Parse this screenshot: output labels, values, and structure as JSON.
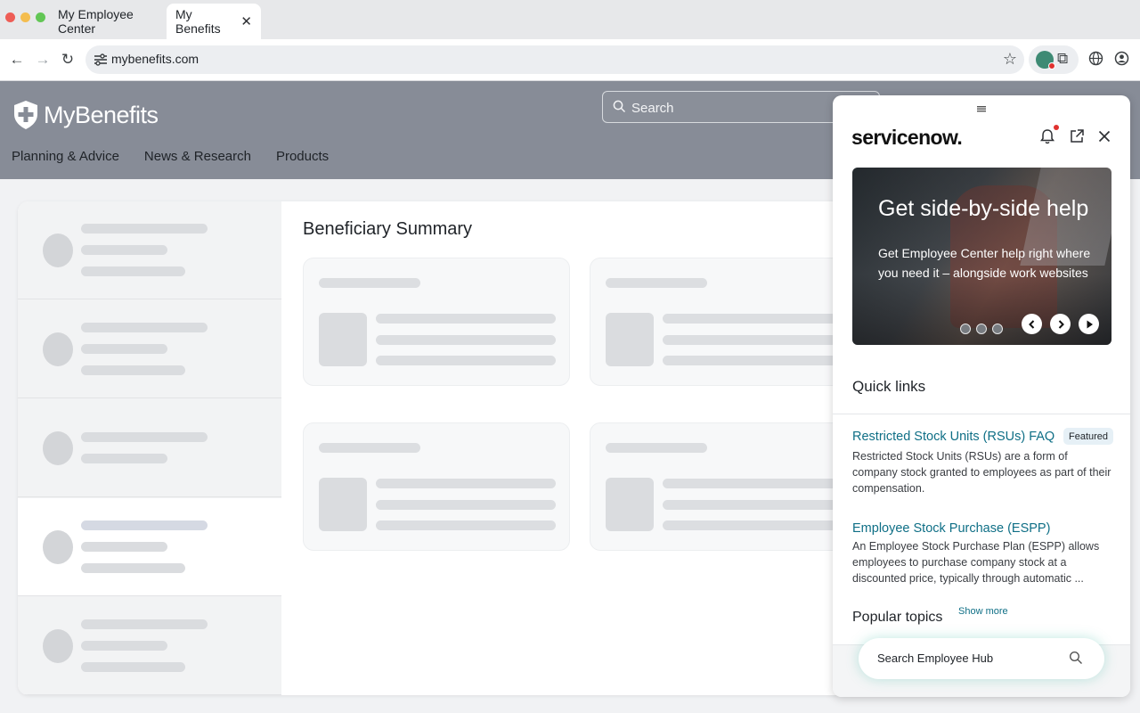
{
  "browser": {
    "tabs": [
      {
        "label": "My Employee Center",
        "active": false
      },
      {
        "label": "My Benefits",
        "active": true
      }
    ],
    "url": "mybenefits.com"
  },
  "site": {
    "brand": "MyBenefits",
    "nav": [
      "Planning & Advice",
      "News & Research",
      "Products"
    ],
    "search_placeholder": "Search",
    "section_title": "Beneficiary Summary",
    "header_color": "#878c97"
  },
  "panel": {
    "logo": "servicenow.",
    "hero": {
      "title": "Get side-by-side help",
      "text": "Get Employee Center help right where you need it – alongside work websites"
    },
    "quick_links_title": "Quick links",
    "links": [
      {
        "title": "Restricted Stock Units (RSUs) FAQ",
        "badge": "Featured",
        "desc": "Restricted Stock Units (RSUs) are a form of company stock granted to employees as part of their compensation."
      },
      {
        "title": "Employee Stock Purchase (ESPP)",
        "desc": "An Employee Stock Purchase Plan (ESPP) allows employees to purchase company stock at a discounted price, typically through automatic ..."
      }
    ],
    "popular_title": "Popular topics",
    "show_more": "Show more",
    "hub_search_placeholder": "Search Employee Hub",
    "accent": "#0f6f86"
  }
}
